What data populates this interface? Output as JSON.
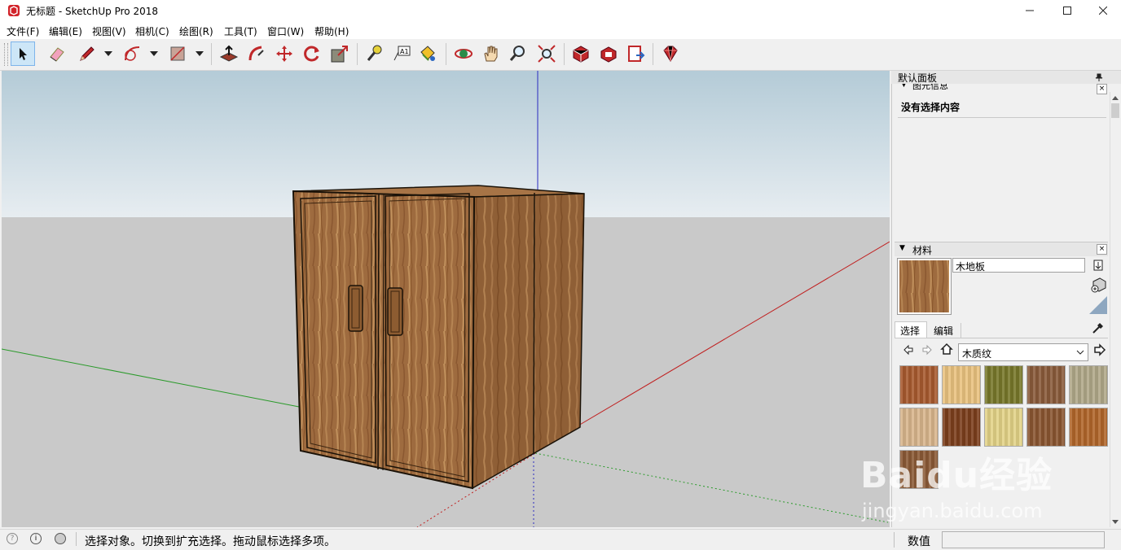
{
  "window": {
    "title": "无标题 - SketchUp Pro 2018"
  },
  "menu": [
    "文件(F)",
    "编辑(E)",
    "视图(V)",
    "相机(C)",
    "绘图(R)",
    "工具(T)",
    "窗口(W)",
    "帮助(H)"
  ],
  "toolbar": {
    "tools": [
      "select-icon",
      "eraser-icon",
      "pencil-icon",
      "arc-icon",
      "rectangle-icon",
      "push-pull-icon",
      "follow-me-icon",
      "move-icon",
      "rotate-icon",
      "scale-icon",
      "tape-measure-icon",
      "text-icon",
      "paint-bucket-icon",
      "orbit-icon",
      "pan-icon",
      "zoom-icon",
      "zoom-extents-icon",
      "3d-warehouse-icon",
      "extension-warehouse-icon",
      "send-to-layout-icon",
      "ruby-icon"
    ]
  },
  "panel": {
    "title": "默认面板",
    "entity_info": {
      "header": "图元信息",
      "empty_text": "没有选择内容"
    },
    "materials": {
      "header": "材料",
      "current_material": "木地板",
      "tabs": [
        "选择",
        "编辑"
      ],
      "collection": "木质纹",
      "swatch_colors": [
        "#a75a2f",
        "#e9c27f",
        "#77772a",
        "#8a5b3b",
        "#b0a889",
        "#d8b58c",
        "#7c3f1c",
        "#e3d387",
        "#8a5631",
        "#b1662a",
        "#8b5a36"
      ]
    }
  },
  "status": {
    "message": "选择对象。切换到扩充选择。拖动鼠标选择多项。",
    "measurements_label": "数值",
    "measurements_value": ""
  },
  "watermark": {
    "main": "Baidu经验",
    "sub": "jingyan.baidu.com"
  },
  "colors": {
    "accent": "#7eb4ea",
    "wood": "#9a6a3e"
  }
}
